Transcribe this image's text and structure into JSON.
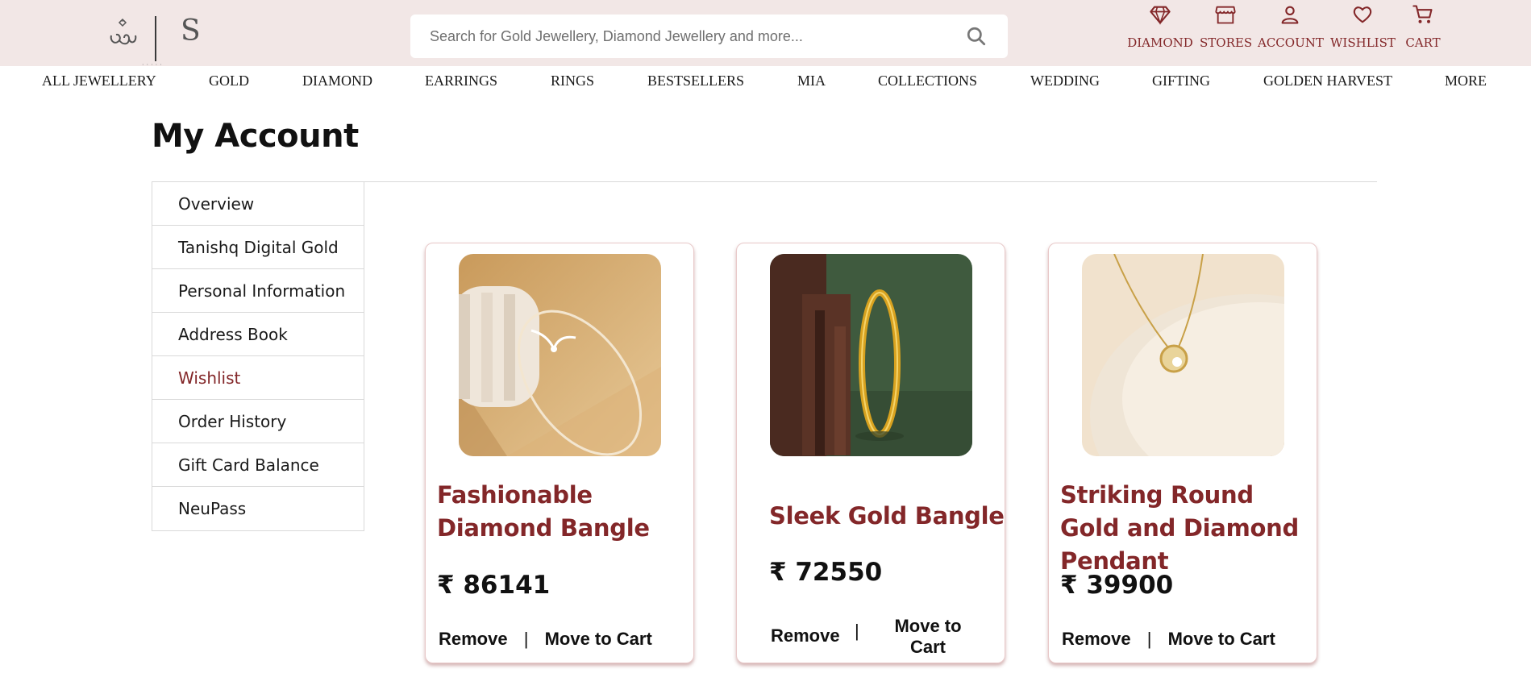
{
  "header": {
    "logo_letter": "S",
    "search_placeholder": "Search for Gold Jewellery, Diamond Jewellery and more...",
    "icons": [
      {
        "name": "diamond-icon",
        "label": "DIAMOND"
      },
      {
        "name": "store-icon",
        "label": "STORES"
      },
      {
        "name": "user-icon",
        "label": "ACCOUNT"
      },
      {
        "name": "heart-icon",
        "label": "WISHLIST"
      },
      {
        "name": "cart-icon",
        "label": "CART"
      }
    ]
  },
  "nav": [
    "ALL JEWELLERY",
    "GOLD",
    "DIAMOND",
    "EARRINGS",
    "RINGS",
    "BESTSELLERS",
    "MIA",
    "COLLECTIONS",
    "WEDDING",
    "GIFTING",
    "GOLDEN HARVEST",
    "MORE"
  ],
  "page": {
    "title": "My Account"
  },
  "sidebar": {
    "items": [
      {
        "label": "Overview"
      },
      {
        "label": "Tanishq Digital Gold"
      },
      {
        "label": "Personal Information"
      },
      {
        "label": "Address Book"
      },
      {
        "label": "Wishlist",
        "active": true
      },
      {
        "label": "Order History"
      },
      {
        "label": "Gift Card Balance"
      },
      {
        "label": "NeuPass"
      }
    ]
  },
  "wishlist": {
    "products": [
      {
        "name": "Fashionable Diamond Bangle",
        "price": "₹ 86141",
        "remove": "Remove",
        "separator": "|",
        "move": "Move to Cart",
        "image": "diamond-bangle-photo"
      },
      {
        "name": "Sleek Gold Bangle",
        "price": "₹ 72550",
        "remove": "Remove",
        "separator": "|",
        "move": "Move to Cart",
        "image": "gold-bangle-photo"
      },
      {
        "name": "Striking Round Gold and Diamond Pendant",
        "price": "₹ 39900",
        "remove": "Remove",
        "separator": "|",
        "move": "Move to Cart",
        "image": "pendant-photo"
      }
    ]
  },
  "colors": {
    "brand": "#832729",
    "header_bg": "#f2e7e6",
    "border": "#d9d9d9"
  }
}
